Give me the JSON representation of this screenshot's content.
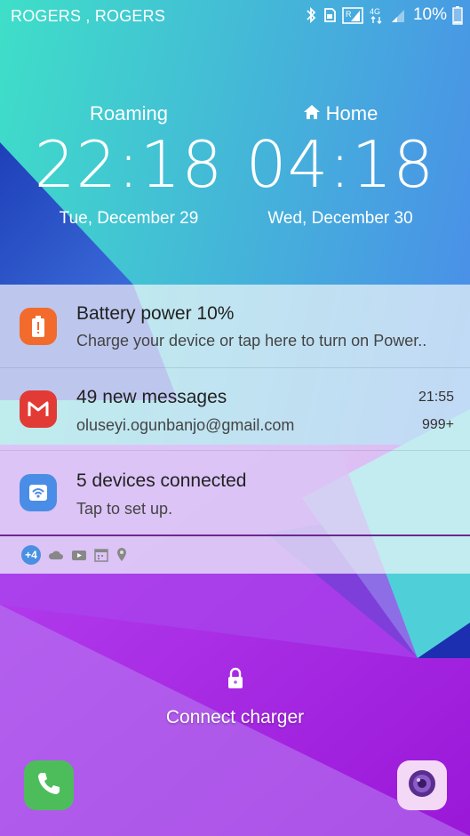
{
  "status_bar": {
    "carrier": "ROGERS , ROGERS",
    "network_type": "4G",
    "battery_percent": "10%",
    "icons": [
      "bluetooth-icon",
      "sd-card-icon",
      "roaming-signal-icon",
      "data-arrows-icon",
      "signal-icon",
      "battery-icon"
    ]
  },
  "clocks": [
    {
      "city": "Roaming",
      "time": "22:18",
      "date": "Tue, December 29",
      "icon": null
    },
    {
      "city": "Home",
      "time": "04:18",
      "date": "Wed, December 30",
      "icon": "home-icon"
    }
  ],
  "notifications": [
    {
      "icon": "battery-warning-icon",
      "icon_color": "#f26b2c",
      "title": "Battery power 10%",
      "body": "Charge your device or tap here to turn on Power..",
      "time": "",
      "count": ""
    },
    {
      "icon": "gmail-icon",
      "icon_color": "#e23a35",
      "title": "49 new messages",
      "body": "oluseyi.ogunbanjo@gmail.com",
      "time": "21:55",
      "count": "999+"
    },
    {
      "icon": "wifi-hotspot-icon",
      "icon_color": "#4a8de6",
      "title": "5 devices connected",
      "body": "Tap to set up.",
      "time": "",
      "count": ""
    }
  ],
  "more_notifications": {
    "badge": "+4",
    "icons": [
      "cloud-icon",
      "youtube-icon",
      "calendar-icon",
      "location-icon"
    ]
  },
  "lock": {
    "icon": "lock-icon",
    "message": "Connect charger"
  },
  "shortcuts": {
    "left": "phone-icon",
    "right": "camera-icon"
  },
  "colors": {
    "accent_purple": "#a12ee0",
    "teal": "#3fd6c8",
    "notification_divider": "#6a2a8c"
  }
}
